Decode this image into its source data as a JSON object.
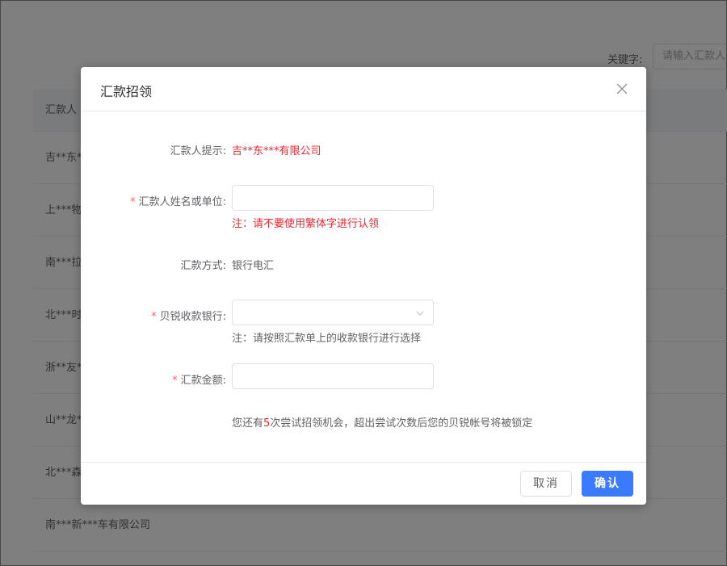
{
  "background": {
    "keyword_label": "关键字:",
    "keyword_placeholder": "请输入汇款人",
    "table_header": "汇款人",
    "rows": [
      "吉**东*",
      "上***物",
      "南***拉",
      "北***时",
      "浙**友*",
      "山**龙*",
      "北***森",
      "南***新***车有限公司"
    ]
  },
  "dialog": {
    "title": "汇款招领",
    "remitter_hint_label": "汇款人提示:",
    "remitter_hint_value": "吉**东***有限公司",
    "name_label": "汇款人姓名或单位:",
    "name_value": "",
    "name_note": "注：请不要使用繁体字进行认领",
    "method_label": "汇款方式:",
    "method_value": "银行电汇",
    "bank_label": "贝锐收款银行:",
    "bank_value": "",
    "bank_note": "注：请按照汇款单上的收款银行进行选择",
    "amount_label": "汇款金额:",
    "amount_value": "",
    "attempts_prefix": "您还有",
    "attempts_count": "5",
    "attempts_suffix": "次尝试招领机会，超出尝试次数后您的贝锐帐号将被锁定",
    "cancel_label": "取消",
    "confirm_label": "确认"
  },
  "colors": {
    "primary": "#3a7afe",
    "danger": "#f5222d",
    "required_star": "#f56c6c"
  }
}
